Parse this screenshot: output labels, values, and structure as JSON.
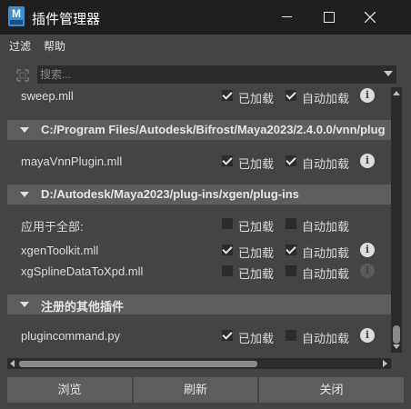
{
  "window": {
    "title": "插件管理器",
    "app_icon_letter": "M"
  },
  "menu": {
    "filter": "过滤",
    "help": "帮助"
  },
  "search": {
    "placeholder": "搜索..."
  },
  "columns": {
    "loaded": "已加载",
    "auto_load": "自动加载"
  },
  "plugins": [
    {
      "name": "sweep.mll",
      "loaded": true,
      "auto_load": true
    },
    {
      "section": "C:/Program Files/Autodesk/Bifrost/Maya2023/2.4.0.0/vnn/plug"
    },
    {
      "name": "mayaVnnPlugin.mll",
      "loaded": true,
      "auto_load": true
    },
    {
      "section": "D:/Autodesk/Maya2023/plug-ins/xgen/plug-ins"
    },
    {
      "name": "应用于全部:",
      "loaded": false,
      "auto_load": false
    },
    {
      "name": "xgenToolkit.mll",
      "loaded": true,
      "auto_load": true
    },
    {
      "name": "xgSplineDataToXpd.mll",
      "loaded": false,
      "auto_load": false
    },
    {
      "section": "注册的其他插件"
    },
    {
      "name": "plugincommand.py",
      "loaded": true,
      "auto_load": false
    }
  ],
  "rows": {
    "r0": "sweep.mll",
    "s1": "C:/Program Files/Autodesk/Bifrost/Maya2023/2.4.0.0/vnn/plug",
    "r2": "mayaVnnPlugin.mll",
    "s3": "D:/Autodesk/Maya2023/plug-ins/xgen/plug-ins",
    "r4": "应用于全部:",
    "r5": "xgenToolkit.mll",
    "r6": "xgSplineDataToXpd.mll",
    "s7": "注册的其他插件",
    "r8": "plugincommand.py"
  },
  "buttons": {
    "browse": "浏览",
    "refresh": "刷新",
    "close": "关闭"
  },
  "colors": {
    "background": "#444444",
    "titlebar": "#1f1f1f",
    "section_header": "#5d5d5d",
    "field": "#2b2b2b",
    "accent": "#3d8fd3"
  },
  "icons": [
    "filter-icon",
    "info-icon",
    "minimize-icon",
    "maximize-icon",
    "close-icon",
    "dropdown-arrow-icon"
  ]
}
